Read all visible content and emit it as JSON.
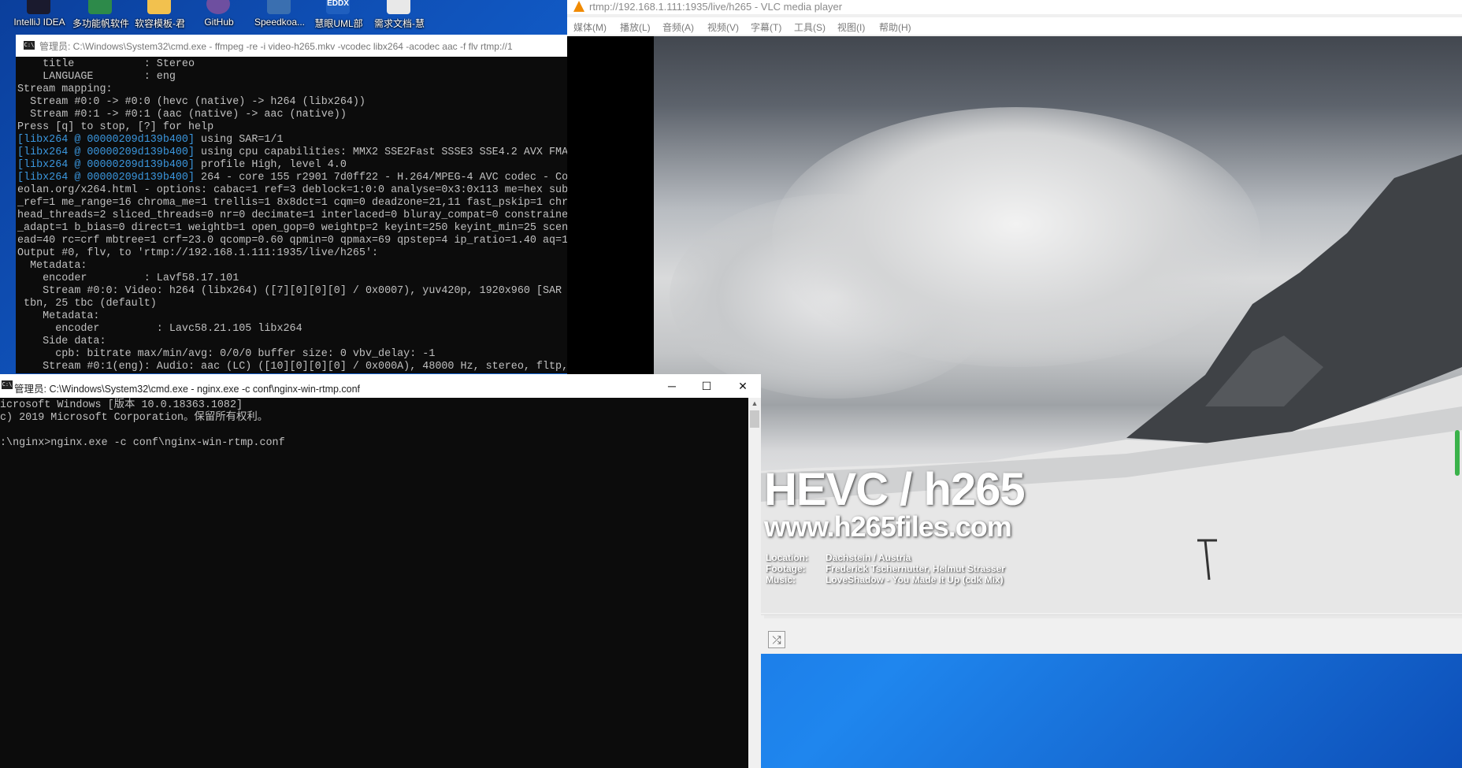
{
  "desktop": {
    "icons": [
      {
        "label": "IntelliJ IDEA",
        "color": "#1a1a2e"
      },
      {
        "label": "多功能帆软件",
        "color": "#2d8a4a"
      },
      {
        "label": "软容模板-君",
        "color": "#f2c14e"
      },
      {
        "label": "GitHub",
        "color": "#6e4fa0"
      },
      {
        "label": "Speedkoa...",
        "color": "#3a6fb0"
      },
      {
        "label": "慧眼UML部",
        "color": "#1f5fbf"
      },
      {
        "label": "需求文档-慧",
        "color": "#e8e8e8"
      }
    ],
    "eddx_badge": "EDDX"
  },
  "vlc": {
    "title": "rtmp://192.168.1.111:1935/live/h265 - VLC media player",
    "menu": [
      "媒体(M)",
      "播放(L)",
      "音频(A)",
      "视频(V)",
      "字幕(T)",
      "工具(S)",
      "视图(I)",
      "帮助(H)"
    ],
    "video_overlay": {
      "title": "HEVC / h265",
      "url": "www.h265files.com",
      "credits": [
        {
          "key": "Location:",
          "value": "Dachstein / Austria"
        },
        {
          "key": "Footage:",
          "value": "Frederick Tschernutter, Helmut Strasser"
        },
        {
          "key": "Music:",
          "value": "LoveShadow - You Made It Up (cdk Mix)"
        }
      ]
    }
  },
  "ffmpeg_console": {
    "title": "管理员: C:\\Windows\\System32\\cmd.exe - ffmpeg  -re -i video-h265.mkv -vcodec libx264 -acodec aac -f flv rtmp://1",
    "lines": [
      {
        "tag": "",
        "text": "    title           : Stereo"
      },
      {
        "tag": "",
        "text": "    LANGUAGE        : eng"
      },
      {
        "tag": "",
        "text": "Stream mapping:"
      },
      {
        "tag": "",
        "text": "  Stream #0:0 -> #0:0 (hevc (native) -> h264 (libx264))"
      },
      {
        "tag": "",
        "text": "  Stream #0:1 -> #0:1 (aac (native) -> aac (native))"
      },
      {
        "tag": "",
        "text": "Press [q] to stop, [?] for help"
      },
      {
        "tag": "[libx264 @ 00000209d139b400]",
        "text": " using SAR=1/1"
      },
      {
        "tag": "[libx264 @ 00000209d139b400]",
        "text": " using cpu capabilities: MMX2 SSE2Fast SSSE3 SSE4.2 AVX FMA"
      },
      {
        "tag": "[libx264 @ 00000209d139b400]",
        "text": " profile High, level 4.0"
      },
      {
        "tag": "[libx264 @ 00000209d139b400]",
        "text": " 264 - core 155 r2901 7d0ff22 - H.264/MPEG-4 AVC codec - Co"
      },
      {
        "tag": "",
        "text": "eolan.org/x264.html - options: cabac=1 ref=3 deblock=1:0:0 analyse=0x3:0x113 me=hex sub"
      },
      {
        "tag": "",
        "text": "_ref=1 me_range=16 chroma_me=1 trellis=1 8x8dct=1 cqm=0 deadzone=21,11 fast_pskip=1 chr"
      },
      {
        "tag": "",
        "text": "head_threads=2 sliced_threads=0 nr=0 decimate=1 interlaced=0 bluray_compat=0 constraine"
      },
      {
        "tag": "",
        "text": "_adapt=1 b_bias=0 direct=1 weightb=1 open_gop=0 weightp=2 keyint=250 keyint_min=25 scen"
      },
      {
        "tag": "",
        "text": "ead=40 rc=crf mbtree=1 crf=23.0 qcomp=0.60 qpmin=0 qpmax=69 qpstep=4 ip_ratio=1.40 aq=1"
      },
      {
        "tag": "",
        "text": "Output #0, flv, to 'rtmp://192.168.1.111:1935/live/h265':"
      },
      {
        "tag": "",
        "text": "  Metadata:"
      },
      {
        "tag": "",
        "text": "    encoder         : Lavf58.17.101"
      },
      {
        "tag": "",
        "text": "    Stream #0:0: Video: h264 (libx264) ([7][0][0][0] / 0x0007), yuv420p, 1920x960 [SAR"
      },
      {
        "tag": "",
        "text": " tbn, 25 tbc (default)"
      },
      {
        "tag": "",
        "text": "    Metadata:"
      },
      {
        "tag": "",
        "text": "      encoder         : Lavc58.21.105 libx264"
      },
      {
        "tag": "",
        "text": "    Side data:"
      },
      {
        "tag": "",
        "text": "      cpb: bitrate max/min/avg: 0/0/0 buffer size: 0 vbv_delay: -1"
      },
      {
        "tag": "",
        "text": "    Stream #0:1(eng): Audio: aac (LC) ([10][0][0][0] / 0x000A), 48000 Hz, stereo, fltp,"
      }
    ]
  },
  "nginx_console": {
    "title": "管理员: C:\\Windows\\System32\\cmd.exe - nginx.exe  -c conf\\nginx-win-rtmp.conf",
    "lines": [
      "icrosoft Windows [版本 10.0.18363.1082]",
      "c) 2019 Microsoft Corporation。保留所有权利。",
      "",
      ":\\nginx>nginx.exe -c conf\\nginx-win-rtmp.conf"
    ],
    "window_buttons": {
      "minimize": "─",
      "maximize": "☐",
      "close": "✕"
    }
  }
}
